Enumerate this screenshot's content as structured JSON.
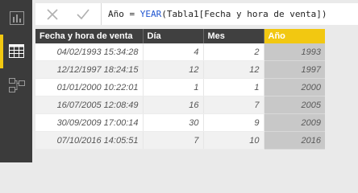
{
  "formula_bar": {
    "cancel_icon": "x-icon",
    "commit_icon": "check-icon",
    "column_name": "Año",
    "operator": " = ",
    "function_name": "YEAR",
    "argument": "(Tabla1[Fecha y hora de venta])"
  },
  "views": [
    {
      "name": "report-view",
      "icon": "bar-chart-icon",
      "active": false
    },
    {
      "name": "data-view",
      "icon": "table-grid-icon",
      "active": true
    },
    {
      "name": "model-view",
      "icon": "relationships-icon",
      "active": false
    }
  ],
  "colors": {
    "accent": "#f2c811",
    "rail": "#3b3b3b",
    "header": "#404040",
    "selected_column": "#c8c8c8",
    "function_keyword": "#1e54d0"
  },
  "table": {
    "columns": [
      "Fecha y hora de venta",
      "Día",
      "Mes",
      "Año"
    ],
    "selected_column": "Año",
    "rows": [
      [
        "04/02/1993 15:34:28",
        "4",
        "2",
        "1993"
      ],
      [
        "12/12/1997 18:24:15",
        "12",
        "12",
        "1997"
      ],
      [
        "01/01/2000 10:22:01",
        "1",
        "1",
        "2000"
      ],
      [
        "16/07/2005 12:08:49",
        "16",
        "7",
        "2005"
      ],
      [
        "30/09/2009 17:00:14",
        "30",
        "9",
        "2009"
      ],
      [
        "07/10/2016 14:05:51",
        "7",
        "10",
        "2016"
      ]
    ]
  }
}
